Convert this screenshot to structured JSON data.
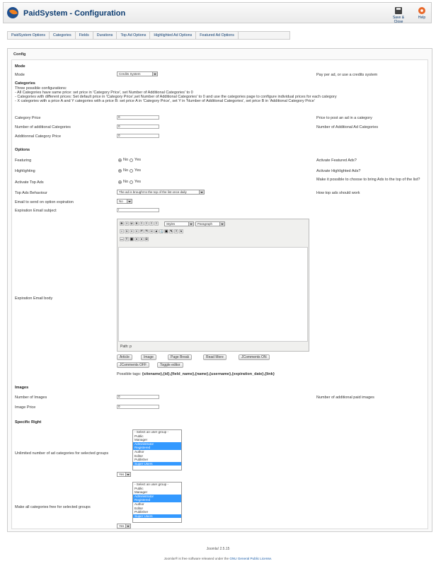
{
  "header": {
    "title": "PaidSystem - Configuration",
    "save_close": "Save & Close",
    "help": "Help"
  },
  "subnav": [
    "PaidSystem Options",
    "Categories",
    "Fields",
    "Durations",
    "Top Ad Options",
    "Highlighted Ad Options",
    "Featured Ad Options"
  ],
  "panel": {
    "legend": "Config"
  },
  "mode": {
    "heading": "Mode",
    "label": "Mode",
    "value": "Credits System",
    "desc": "Pay per ad, or use a credits system"
  },
  "categories": {
    "heading": "Categories",
    "lines": [
      "Three possible configurations:",
      "- All Categories have same price: set price in 'Category Price', set Number of Additional Categories' to 0",
      "- Categories with different prices: Set default price in 'Category Price',set Number of Additional Categories' to 0 and use the categories page to configure individual prices for each category",
      "- X categories with a price A and Y categories with a price B: set price A in 'Category Price', set Y in 'Number of Additional Categories', set price B in 'Additional Category Price'"
    ],
    "price_label": "Category Price",
    "price_value": "0",
    "price_desc": "Price to post an ad in a category",
    "num_label": "Number of additional Categories",
    "num_value": "0",
    "num_desc": "Number of Additional Ad Categories",
    "add_label": "Additionnal Category Price",
    "add_value": "0"
  },
  "options": {
    "heading": "Options",
    "featuring_label": "Featuring",
    "featuring_desc": "Activate Featured Ads?",
    "highlighting_label": "Highlighting",
    "highlighting_desc": "Activate Highlighted Ads?",
    "topads_label": "Activate Top Ads",
    "topads_desc": "Make it possible to choose to bring Ads to the top of the list?",
    "no": "No",
    "yes": "Yes",
    "behaviour_label": "Top Ads Behaviour",
    "behaviour_value": "The ad is brought to the top of the list once daily",
    "behaviour_desc": "How top ads should work",
    "email_label": "Email to send on option expiration",
    "email_value": "No",
    "subject_label": "Expiration Email subject",
    "subject_value": "/",
    "body_label": "Expiration Email body",
    "styles": "Styles",
    "paragraph": "Paragraph",
    "path": "Path: p",
    "buttons": [
      "Article",
      "Image",
      "Page Break",
      "Read More",
      "JComments ON",
      "JComments OFF",
      "Toggle editor"
    ],
    "tags_label": "Possible tags:",
    "tags": "{sitename},{id},{field_name},{name},{username},{expiration_date},{link}"
  },
  "images": {
    "heading": "Images",
    "num_label": "Number of Images",
    "num_value": "0",
    "num_desc": "Number of additional paid images",
    "price_label": "Image Price",
    "price_value": "0"
  },
  "specific": {
    "heading": "Specific Right",
    "unlimited_label": "Unlimited number of ad categories for selected groups",
    "free_label": "Make all categories free for selected groups",
    "groups": [
      "- Select an user group -",
      "Public",
      "Manager",
      "Administrator",
      "Registered",
      "Author",
      "Editor",
      "Publisher",
      "Super Users"
    ],
    "groups2": [
      "- Select an user group -",
      "Public",
      "Manager",
      "Administrator",
      "Registered",
      "Author",
      "Editor",
      "Publisher",
      "Super Users"
    ],
    "yes": "Yes"
  },
  "footer": {
    "version": "Joomla! 2.5.15",
    "text_pre": "Joomla!® is free software released under the",
    "link": "GNU General Public License."
  }
}
